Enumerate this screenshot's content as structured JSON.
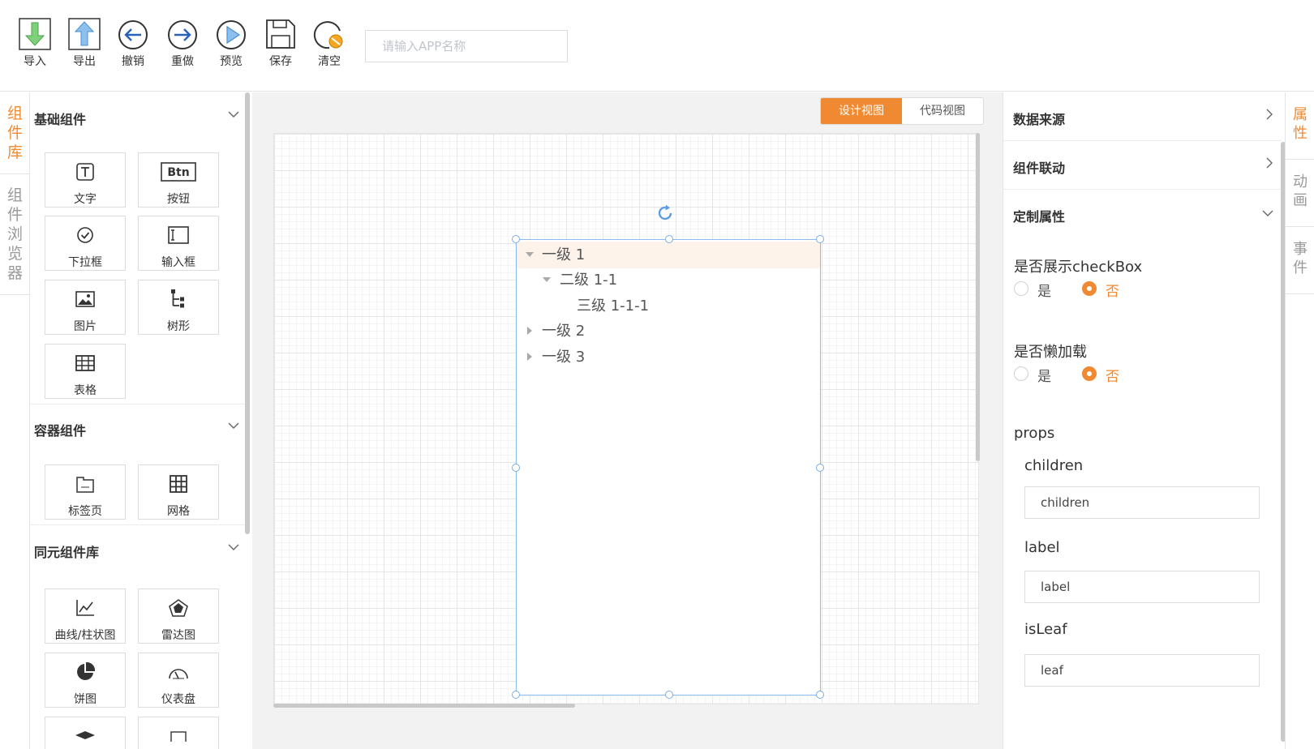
{
  "toolbar": {
    "import": "导入",
    "export": "导出",
    "undo": "撤销",
    "redo": "重做",
    "preview": "预览",
    "save": "保存",
    "clear": "清空",
    "app_name_placeholder": "请输入APP名称"
  },
  "left_tabs": {
    "components": "组\n件\n库",
    "browser": "组\n件\n浏\n览\n器"
  },
  "sections": {
    "basic": {
      "title": "基础组件",
      "items": [
        "文字",
        "按钮",
        "下拉框",
        "输入框",
        "图片",
        "树形",
        "表格"
      ]
    },
    "container": {
      "title": "容器组件",
      "items": [
        "标签页",
        "网格"
      ]
    },
    "tongyuan": {
      "title": "同元组件库",
      "items": [
        "曲线/柱状图",
        "雷达图",
        "饼图",
        "仪表盘"
      ]
    }
  },
  "btn_icon_text": "Btn",
  "view": {
    "design": "设计视图",
    "code": "代码视图"
  },
  "tree": [
    {
      "label": "一级 1"
    },
    {
      "label": "二级 1-1"
    },
    {
      "label": "三级 1-1-1"
    },
    {
      "label": "一级 2"
    },
    {
      "label": "一级 3"
    }
  ],
  "props": {
    "data_source": "数据来源",
    "linkage": "组件联动",
    "custom": "定制属性",
    "show_checkbox_label": "是否展示checkBox",
    "lazy_label": "是否懒加载",
    "yes": "是",
    "no": "否",
    "props_label": "props",
    "children_label": "children",
    "children_value": "children",
    "label_label": "label",
    "label_value": "label",
    "isleaf_label": "isLeaf",
    "isleaf_value": "leaf"
  },
  "right_tabs": {
    "attributes": "属\n性",
    "animation": "动\n画",
    "events": "事\n件"
  },
  "colors": {
    "accent": "#f08a32",
    "selection": "#8dbcf0"
  }
}
